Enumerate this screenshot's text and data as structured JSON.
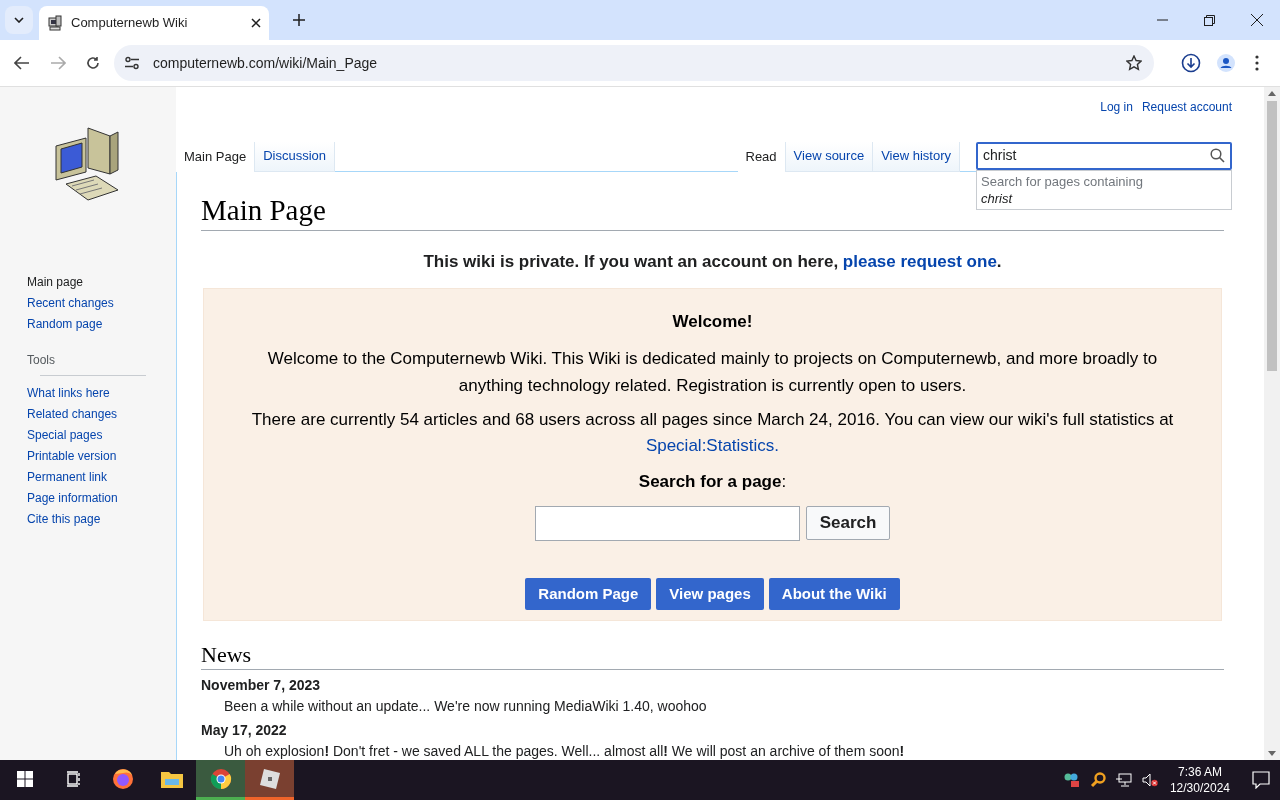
{
  "browser": {
    "tab_title": "Computernewb Wiki",
    "url": "computernewb.com/wiki/Main_Page"
  },
  "personal_links": [
    "Log in",
    "Request account"
  ],
  "navigation": [
    {
      "label": "Main page",
      "selected": true
    },
    {
      "label": "Recent changes",
      "selected": false
    },
    {
      "label": "Random page",
      "selected": false
    }
  ],
  "tools": {
    "heading": "Tools",
    "items": [
      "What links here",
      "Related changes",
      "Special pages",
      "Printable version",
      "Permanent link",
      "Page information",
      "Cite this page"
    ]
  },
  "left_tabs": [
    {
      "label": "Main Page",
      "selected": true
    },
    {
      "label": "Discussion",
      "selected": false
    }
  ],
  "right_tabs": [
    {
      "label": "Read",
      "selected": true
    },
    {
      "label": "View source",
      "selected": false
    },
    {
      "label": "View history",
      "selected": false
    }
  ],
  "search": {
    "value": "christ",
    "suggestion_label": "Search for pages containing",
    "suggestion_term": "christ"
  },
  "title": "Main Page",
  "notice": {
    "text": "This wiki is private. If you want an account on here, ",
    "link": "please request one",
    "end": "."
  },
  "welcome": {
    "heading": "Welcome!",
    "paragraph": "Welcome to the Computernewb Wiki. This Wiki is dedicated mainly to projects on Computernewb, and more broadly to anything technology related. Registration is currently open to users.",
    "stats_text": "There are currently 54 articles and 68 users across all pages since March 24, 2016. You can view our wiki's full statistics at",
    "stats_link": "Special:Statistics.",
    "search_label": "**Search for a page**:",
    "search_button": "Search",
    "buttons": [
      "Random Page",
      "View pages",
      "About the Wiki"
    ]
  },
  "news": {
    "heading": "News",
    "entries": [
      {
        "date": "November 7, 2023",
        "text": "Been a while without an update... We're now running MediaWiki 1.40, woohoo"
      },
      {
        "date": "May 17, 2022",
        "text": "Uh oh explosion**!** Don't fret - we saved ALL the pages. Well... almost all**!** We will post an archive of them soon**!**"
      }
    ]
  },
  "taskbar": {
    "apps": [
      {
        "kind": "start",
        "active": false
      },
      {
        "kind": "taskview",
        "active": false
      },
      {
        "kind": "firefox",
        "active": false
      },
      {
        "kind": "files",
        "active": false
      },
      {
        "kind": "chrome",
        "active": true
      },
      {
        "kind": "roblox",
        "active": true
      }
    ],
    "time": "7:36 AM",
    "date": "12/30/2024"
  }
}
